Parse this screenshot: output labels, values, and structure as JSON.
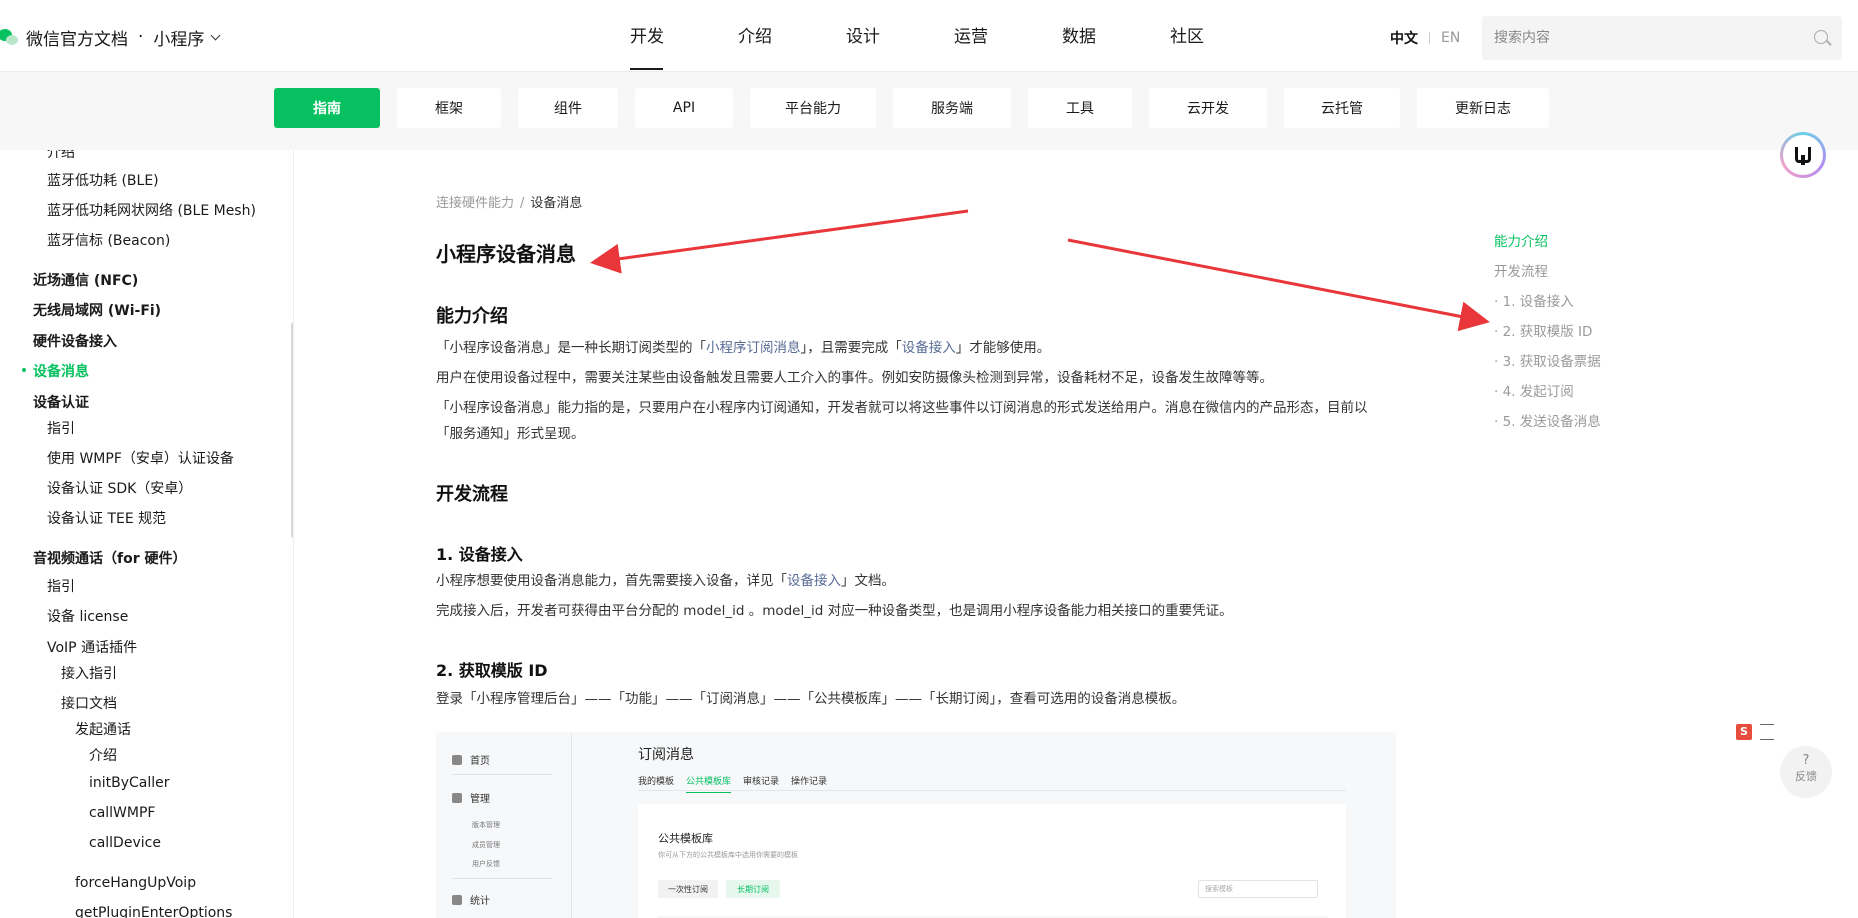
{
  "header": {
    "site_name": "微信官方文档",
    "separator": "·",
    "product": "小程序",
    "nav": [
      {
        "label": "开发",
        "active": true
      },
      {
        "label": "介绍",
        "active": false
      },
      {
        "label": "设计",
        "active": false
      },
      {
        "label": "运营",
        "active": false
      },
      {
        "label": "数据",
        "active": false
      },
      {
        "label": "社区",
        "active": false
      }
    ],
    "lang_zh": "中文",
    "lang_en": "EN",
    "search_placeholder": "搜索内容"
  },
  "subnav": [
    {
      "label": "指南",
      "active": true
    },
    {
      "label": "框架"
    },
    {
      "label": "组件"
    },
    {
      "label": "API"
    },
    {
      "label": "平台能力"
    },
    {
      "label": "服务端"
    },
    {
      "label": "工具"
    },
    {
      "label": "云开发"
    },
    {
      "label": "云托管"
    },
    {
      "label": "更新日志"
    }
  ],
  "sidebar": {
    "items": [
      {
        "label": "介绍",
        "level": 2
      },
      {
        "label": "蓝牙低功耗 (BLE)",
        "level": 2
      },
      {
        "label": "蓝牙低功耗网状网络 (BLE Mesh)",
        "level": 2
      },
      {
        "label": "蓝牙信标 (Beacon)",
        "level": 2
      },
      {
        "label": "近场通信 (NFC)",
        "level": 1
      },
      {
        "label": "无线局域网 (Wi-Fi)",
        "level": 1
      },
      {
        "label": "硬件设备接入",
        "level": 1
      },
      {
        "label": "设备消息",
        "level": 1,
        "active": true
      },
      {
        "label": "设备认证",
        "level": 1
      },
      {
        "label": "指引",
        "level": 2
      },
      {
        "label": "使用 WMPF（安卓）认证设备",
        "level": 2
      },
      {
        "label": "设备认证 SDK（安卓）",
        "level": 2
      },
      {
        "label": "设备认证 TEE 规范",
        "level": 2
      },
      {
        "label": "音视频通话（for 硬件）",
        "level": 1
      },
      {
        "label": "指引",
        "level": 2
      },
      {
        "label": "设备 license",
        "level": 2
      },
      {
        "label": "VoIP 通话插件",
        "level": 2
      },
      {
        "label": "接入指引",
        "level": 3
      },
      {
        "label": "接口文档",
        "level": 3
      },
      {
        "label": "发起通话",
        "level": 4
      },
      {
        "label": "介绍",
        "level": 5
      },
      {
        "label": "initByCaller",
        "level": 5
      },
      {
        "label": "callWMPF",
        "level": 5
      },
      {
        "label": "callDevice",
        "level": 5
      },
      {
        "label": "forceHangUpVoip",
        "level": 4
      },
      {
        "label": "getPluginEnterOptions",
        "level": 4
      }
    ]
  },
  "content": {
    "breadcrumb": {
      "parent": "连接硬件能力",
      "sep": "/",
      "current": "设备消息"
    },
    "title": "小程序设备消息",
    "sec1": {
      "heading": "能力介绍",
      "p1_a": "「小程序设备消息」是一种长期订阅类型的「",
      "p1_link1": "小程序订阅消息",
      "p1_b": "」，且需要完成「",
      "p1_link2": "设备接入",
      "p1_c": "」才能够使用。",
      "p2": "用户在使用设备过程中，需要关注某些由设备触发且需要人工介入的事件。例如安防摄像头检测到异常，设备耗材不足，设备发生故障等等。",
      "p3": "「小程序设备消息」能力指的是，只要用户在小程序内订阅通知，开发者就可以将这些事件以订阅消息的形式发送给用户。消息在微信内的产品形态，目前以「服务通知」形式呈现。"
    },
    "sec2": {
      "heading": "开发流程"
    },
    "step1": {
      "heading": "1. 设备接入",
      "p1_a": "小程序想要使用设备消息能力，首先需要接入设备，详见「",
      "p1_link": "设备接入",
      "p1_b": "」文档。",
      "p2": "完成接入后，开发者可获得由平台分配的 model_id 。model_id 对应一种设备类型，也是调用小程序设备能力相关接口的重要凭证。"
    },
    "step2": {
      "heading": "2. 获取模版 ID",
      "p1": "登录「小程序管理后台」——「功能」——「订阅消息」——「公共模板库」——「长期订阅」，查看可选用的设备消息模板。"
    }
  },
  "shot": {
    "nav_home": "首页",
    "nav_manage": "管理",
    "sub1": "版本管理",
    "sub2": "成员管理",
    "sub3": "用户反馈",
    "nav_stats": "统计",
    "title": "订阅消息",
    "tabs": [
      "我的模板",
      "公共模板库",
      "审核记录",
      "操作记录"
    ],
    "card_title": "公共模板库",
    "card_desc": "你可从下方的公共模板库中选用你需要的模板",
    "btn_once": "一次性订阅",
    "btn_long": "长期订阅",
    "search_ph": "搜索模板"
  },
  "toc": [
    {
      "label": "能力介绍",
      "active": true
    },
    {
      "label": "开发流程"
    },
    {
      "label": "· 1. 设备接入"
    },
    {
      "label": "· 2. 获取模版 ID"
    },
    {
      "label": "· 3. 获取设备票据"
    },
    {
      "label": "· 4. 发起订阅"
    },
    {
      "label": "· 5. 发送设备消息"
    }
  ],
  "widgets": {
    "feedback_q": "?",
    "feedback_label": "反馈",
    "sohu": "S"
  },
  "colors": {
    "accent": "#07c160",
    "link": "#576b95",
    "arrow": "#e8363a"
  }
}
